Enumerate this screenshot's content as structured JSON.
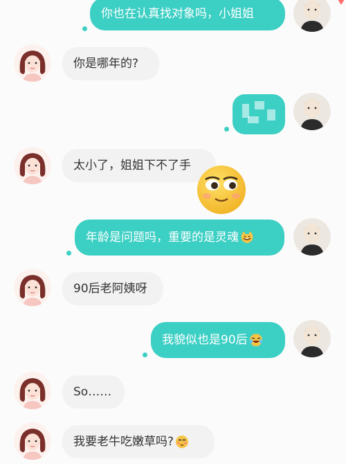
{
  "messages": [
    {
      "side": "out",
      "text": "你也在认真找对象吗，小姐姐"
    },
    {
      "side": "in",
      "text": "你是哪年的?"
    },
    {
      "side": "out",
      "text": ""
    },
    {
      "side": "in",
      "text": "太小了，姐姐下不了手"
    },
    {
      "side": "out",
      "text": "年龄是问题吗，重要的是灵魂"
    },
    {
      "side": "in",
      "text": "90后老阿姨呀"
    },
    {
      "side": "out",
      "text": "我貌似也是90后"
    },
    {
      "side": "in",
      "text": "So……"
    },
    {
      "side": "in",
      "text": "我要老牛吃嫩草吗?"
    }
  ],
  "icons": {
    "sticker": "dizzy-eyes-sticker",
    "emoji_soul": "cat-grin-emoji",
    "emoji_90": "laughing-tears-emoji",
    "emoji_grass": "blushing-face-emoji"
  },
  "colors": {
    "outgoing_bubble": "#3ccfc4",
    "incoming_bubble": "#f2f2f2",
    "incoming_text": "#333333"
  }
}
